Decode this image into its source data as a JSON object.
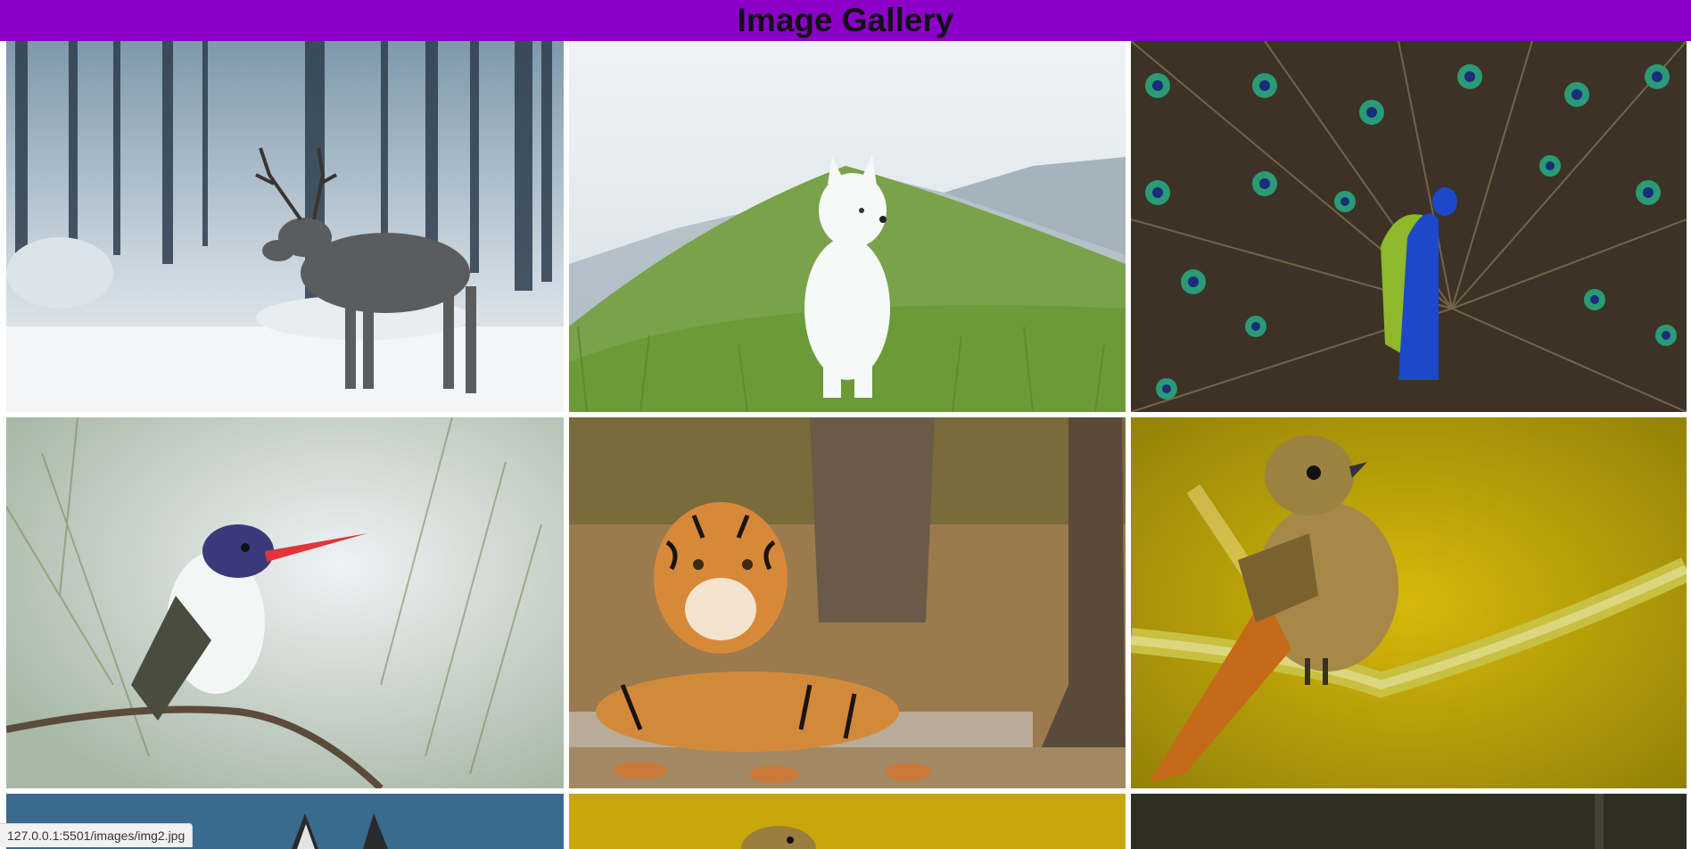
{
  "header": {
    "title": "Image Gallery",
    "color": "#8a00c8"
  },
  "gallery": {
    "images": [
      {
        "subject": "reindeer-in-snowy-forest"
      },
      {
        "subject": "white-dog-on-grassy-hill"
      },
      {
        "subject": "peacock-fanned-tail"
      },
      {
        "subject": "hummingbird-on-pine-branch"
      },
      {
        "subject": "tiger-resting-in-forest"
      },
      {
        "subject": "redstart-bird-on-mossy-branch"
      },
      {
        "subject": "wolf-partial"
      },
      {
        "subject": "bird-on-yellow-partial"
      },
      {
        "subject": "dark-forest-partial"
      }
    ]
  },
  "status_bar": {
    "url": "127.0.0.1:5501/images/img2.jpg"
  }
}
